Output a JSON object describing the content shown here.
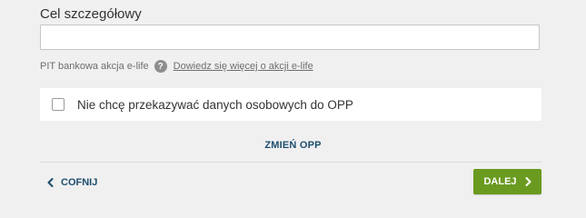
{
  "goal_field": {
    "label": "Cel szczegółowy",
    "value": "",
    "placeholder": ""
  },
  "hint": {
    "text": "PIT bankowa akcja e-life",
    "help_icon": "question-mark-icon",
    "link": "Dowiedz się więcej o akcji e-life"
  },
  "consent": {
    "label": "Nie chcę przekazywać danych osobowych do OPP",
    "checked": false
  },
  "change_opp": {
    "label": "ZMIEŃ OPP"
  },
  "navigation": {
    "back_label": "COFNIJ",
    "back_icon": "chevron-left-icon",
    "next_label": "DALEJ",
    "next_icon": "chevron-right-icon"
  },
  "colors": {
    "background": "#f0f0f0",
    "link_dark_blue": "#1d4e6e",
    "primary_green": "#6a9a1f",
    "muted_text": "#6e6e6e"
  }
}
